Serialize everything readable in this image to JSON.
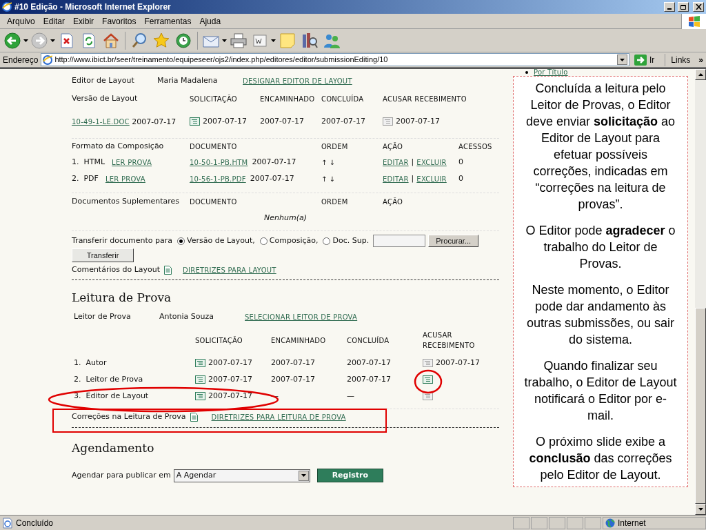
{
  "window": {
    "title": "#10 Edição - Microsoft Internet Explorer"
  },
  "menu": [
    "Arquivo",
    "Editar",
    "Exibir",
    "Favoritos",
    "Ferramentas",
    "Ajuda"
  ],
  "address": {
    "label": "Endereço",
    "url": "http://www.ibict.br/seer/treinamento/equipeseer/ojs2/index.php/editores/editor/submissionEditing/10",
    "go": "Ir",
    "links": "Links",
    "more": "»"
  },
  "page": {
    "top_item": "Por Título",
    "layout": {
      "role": "Editor de Layout",
      "person": "Maria Madalena",
      "assign_link": "DESIGNAR EDITOR DE LAYOUT",
      "version_label": "Versão de Layout",
      "version_columns": [
        "SOLICITAÇÃO",
        "ENCAMINHADO",
        "CONCLUÍDA",
        "ACUSAR RECEBIMENTO"
      ],
      "version_file": "10-49-1-LE.DOC",
      "version_date": "2007-07-17",
      "version_cells": [
        "2007-07-17",
        "2007-07-17",
        "2007-07-17",
        "2007-07-17"
      ],
      "version_ack_enabled": false,
      "galley_label": "Formato da Composição",
      "galley_columns": [
        "DOCUMENTO",
        "ORDEM",
        "AÇÃO",
        "ACESSOS"
      ],
      "galleys": [
        {
          "index": "1.",
          "format": "HTML",
          "read_link": "LER PROVA",
          "file": "10-50-1-PB.HTM",
          "date": "2007-07-17",
          "order": "↑ ↓",
          "edit": "EDITAR",
          "separator": "|",
          "delete": "EXCLUIR",
          "views": "0"
        },
        {
          "index": "2.",
          "format": "PDF",
          "read_link": "LER PROVA",
          "file": "10-56-1-PB.PDF",
          "date": "2007-07-17",
          "order": "↑ ↓",
          "edit": "EDITAR",
          "separator": "|",
          "delete": "EXCLUIR",
          "views": "0"
        }
      ],
      "supp_label": "Documentos Suplementares",
      "supp_columns": [
        "DOCUMENTO",
        "ORDEM",
        "AÇÃO"
      ],
      "supp_empty": "Nenhum(a)",
      "upload": {
        "label": "Transferir documento para",
        "options": [
          {
            "label": "Versão de Layout,",
            "selected": true
          },
          {
            "label": "Composição,",
            "selected": false
          },
          {
            "label": "Doc. Sup.",
            "selected": false
          }
        ],
        "browse": "Procurar...",
        "submit": "Transferir"
      },
      "comments_label": "Comentários do Layout",
      "guidelines_link": "DIRETRIZES PARA LAYOUT"
    },
    "proofreading": {
      "heading": "Leitura de Prova",
      "role": "Leitor de Prova",
      "person": "Antonia Souza",
      "select_link": "SELECIONAR LEITOR DE PROVA",
      "columns": [
        "SOLICITAÇÃO",
        "ENCAMINHADO",
        "CONCLUÍDA",
        "ACUSAR RECEBIMENTO"
      ],
      "rows": [
        {
          "index": "1.",
          "name": "Autor",
          "requested": "2007-07-17",
          "underway": "2007-07-17",
          "completed": "2007-07-17",
          "acknowledged": "2007-07-17",
          "ack_enabled": false
        },
        {
          "index": "2.",
          "name": "Leitor de Prova",
          "requested": "2007-07-17",
          "underway": "2007-07-17",
          "completed": "2007-07-17",
          "ack_enabled": true
        },
        {
          "index": "3.",
          "name": "Editor de Layout",
          "requested": "2007-07-17",
          "underway": "—",
          "completed": "—",
          "ack_enabled": false
        }
      ],
      "corrections_label": "Correções na Leitura de Prova",
      "corrections_link": "DIRETRIZES PARA LEITURA DE PROVA"
    },
    "scheduling": {
      "heading": "Agendamento",
      "label": "Agendar para publicar em",
      "value": "A Agendar",
      "button": "Registro"
    }
  },
  "callout": {
    "paragraphs": [
      "Concluída a leitura pelo Leitor de Provas, o Editor deve enviar **solicitação** ao Editor de Layout para efetuar possíveis correções, indicadas em “correções na leitura de provas”.",
      "O Editor pode **agradecer** o trabalho do Leitor de Provas.",
      "Neste momento, o Editor pode dar andamento às outras submissões, ou sair do sistema.",
      "Quando finalizar seu trabalho, o Editor de Layout notificará o Editor por e-mail.",
      "O próximo slide exibe a **conclusão** das correções pelo Editor de Layout."
    ]
  },
  "status": {
    "text": "Concluído",
    "zone": "Internet"
  }
}
